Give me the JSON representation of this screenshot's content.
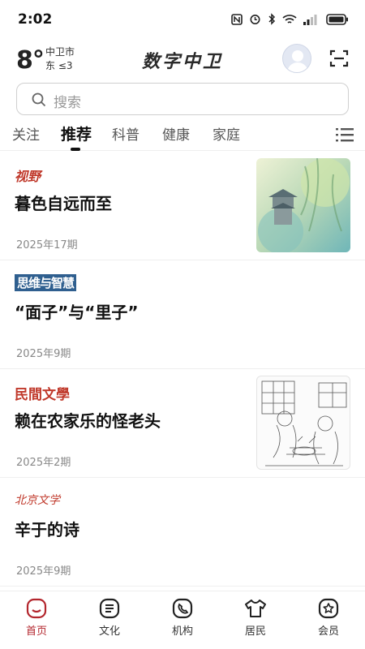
{
  "status": {
    "time": "2:02"
  },
  "header": {
    "temperature": "8°",
    "city": "中卫市",
    "wind": "东 ≤3",
    "app_title": "数字中卫"
  },
  "search": {
    "placeholder": "搜索"
  },
  "tabs": [
    {
      "label": "关注"
    },
    {
      "label": "推荐"
    },
    {
      "label": "科普"
    },
    {
      "label": "健康"
    },
    {
      "label": "家庭"
    }
  ],
  "feed": [
    {
      "source": "视野",
      "title": "暮色自远而至",
      "issue": "2025年17期",
      "has_image": true
    },
    {
      "source": "思维与智慧",
      "title": "“面子”与“里子”",
      "issue": "2025年9期",
      "has_image": false
    },
    {
      "source": "民間文學",
      "title": "赖在农家乐的怪老头",
      "issue": "2025年2期",
      "has_image": true
    },
    {
      "source": "北京文学",
      "title": "辛于的诗",
      "issue": "2025年9期",
      "has_image": false
    }
  ],
  "bottom_nav": [
    {
      "label": "首页",
      "icon": "home-icon",
      "active": true
    },
    {
      "label": "文化",
      "icon": "culture-icon",
      "active": false
    },
    {
      "label": "机构",
      "icon": "phone-icon",
      "active": false
    },
    {
      "label": "居民",
      "icon": "shirt-icon",
      "active": false
    },
    {
      "label": "会员",
      "icon": "star-icon",
      "active": false
    }
  ],
  "colors": {
    "accent": "#b3262d",
    "source_red": "#c0392b",
    "source_blue": "#2f5f8f"
  }
}
